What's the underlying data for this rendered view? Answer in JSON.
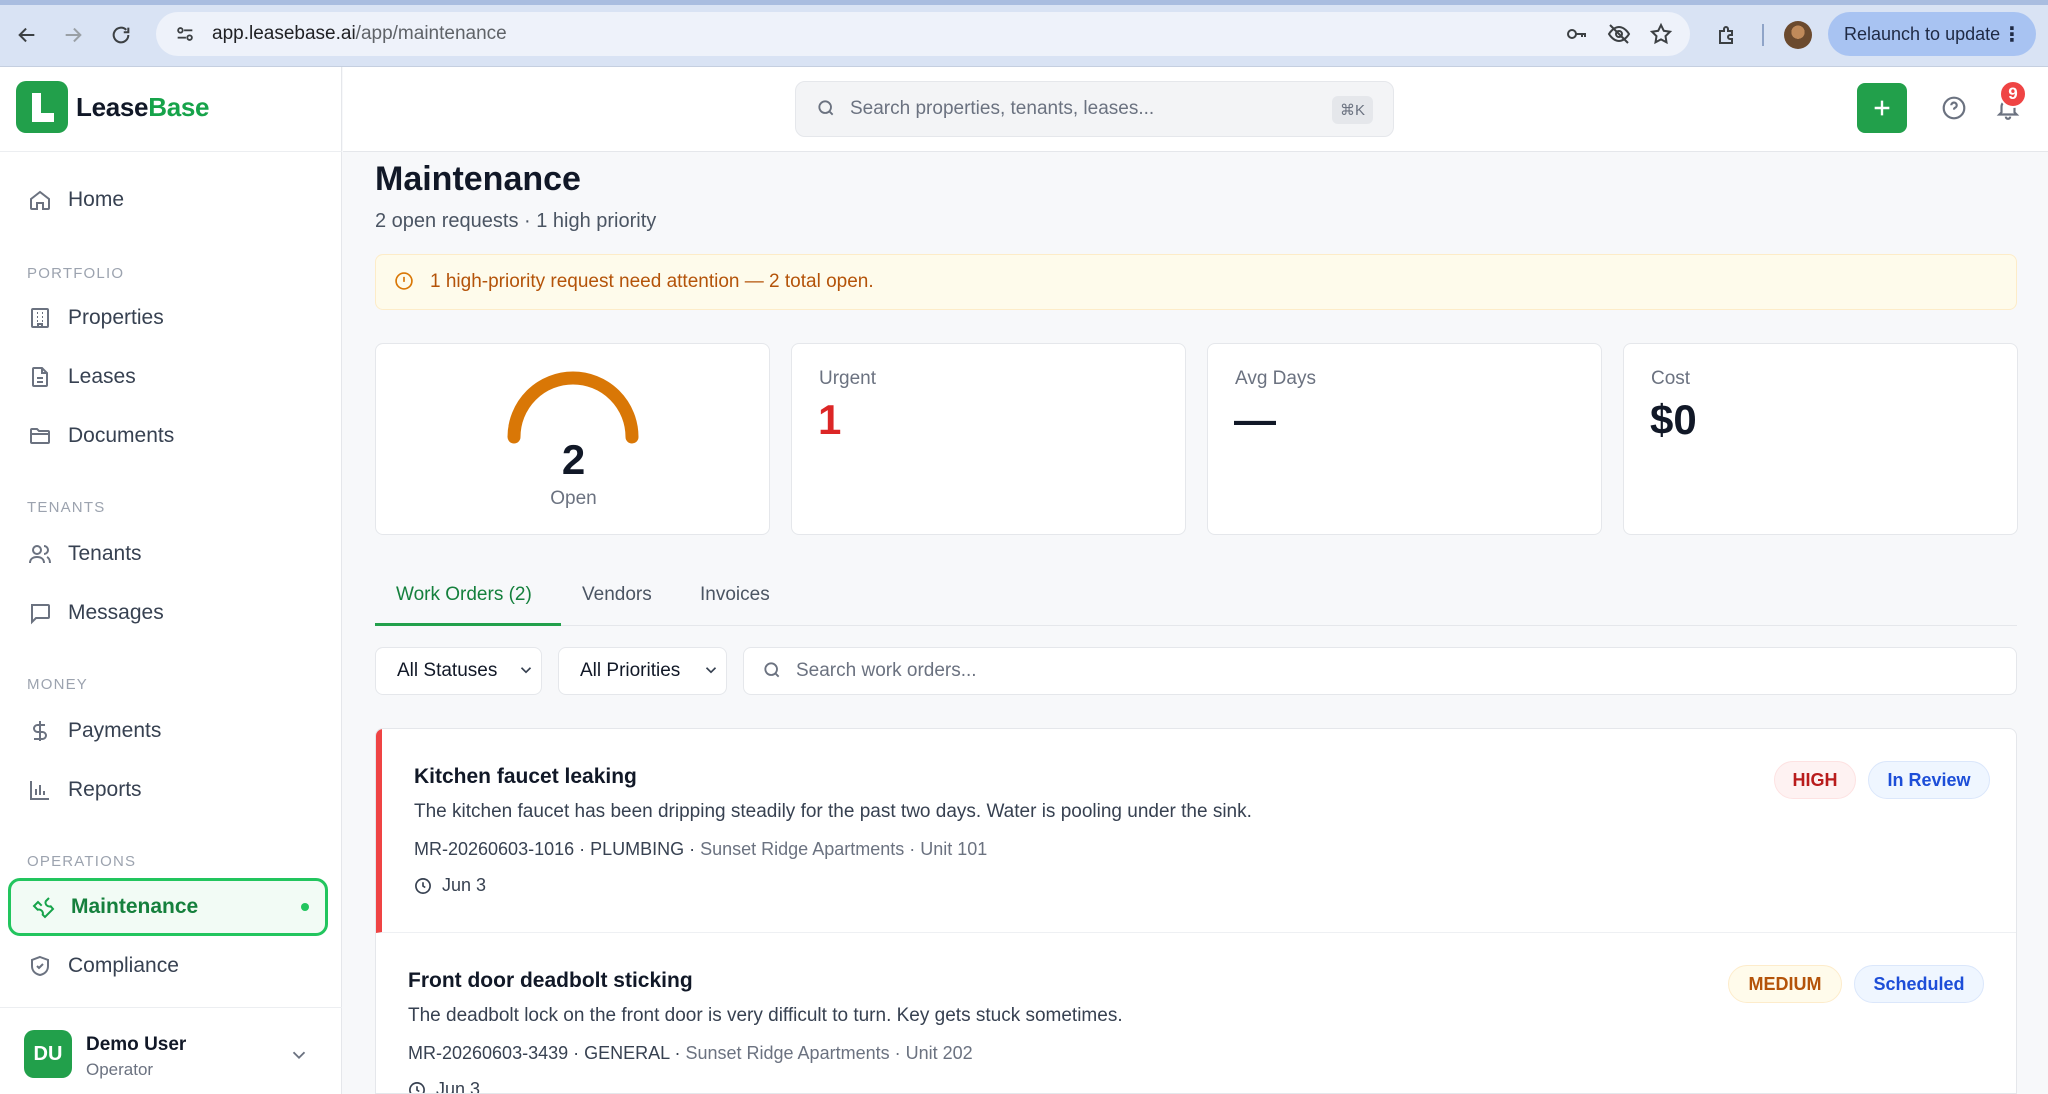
{
  "browser": {
    "url_domain": "app.leasebase.ai",
    "url_path": "/app/maintenance",
    "relaunch_label": "Relaunch to update"
  },
  "brand": {
    "name_part1": "Lease",
    "name_part2": "Base",
    "logo_letter": "L"
  },
  "sidebar": {
    "home": "Home",
    "sections": {
      "portfolio": "PORTFOLIO",
      "tenants": "TENANTS",
      "money": "MONEY",
      "operations": "OPERATIONS"
    },
    "items": {
      "properties": "Properties",
      "leases": "Leases",
      "documents": "Documents",
      "tenants": "Tenants",
      "messages": "Messages",
      "payments": "Payments",
      "reports": "Reports",
      "maintenance": "Maintenance",
      "compliance": "Compliance"
    },
    "user": {
      "initials": "DU",
      "name": "Demo User",
      "role": "Operator"
    }
  },
  "topbar": {
    "search_placeholder": "Search properties, tenants, leases...",
    "shortcut": "⌘K",
    "notification_count": "9"
  },
  "page": {
    "title": "Maintenance",
    "subtitle": "2 open requests · 1 high priority",
    "alert": "1 high-priority request need attention — 2 total open."
  },
  "stats": {
    "open_value": "2",
    "open_label": "Open",
    "urgent_label": "Urgent",
    "urgent_value": "1",
    "avg_label": "Avg Days",
    "avg_value": "—",
    "cost_label": "Cost",
    "cost_value": "$0"
  },
  "tabs": {
    "work_orders": "Work Orders (2)",
    "vendors": "Vendors",
    "invoices": "Invoices"
  },
  "filters": {
    "status": "All Statuses",
    "priority": "All Priorities",
    "search_placeholder": "Search work orders..."
  },
  "work_orders": [
    {
      "title": "Kitchen faucet leaking",
      "description": "The kitchen faucet has been dripping steadily for the past two days. Water is pooling under the sink.",
      "meta_id": "MR-20260603-1016 · PLUMBING · ",
      "meta_property": "Sunset Ridge Apartments · Unit 101",
      "date": "Jun 3",
      "priority": "HIGH",
      "status": "In Review"
    },
    {
      "title": "Front door deadbolt sticking",
      "description": "The deadbolt lock on the front door is very difficult to turn. Key gets stuck sometimes.",
      "meta_id": "MR-20260603-3439 · GENERAL · ",
      "meta_property": "Sunset Ridge Apartments · Unit 202",
      "date": "Jun 3",
      "priority": "MEDIUM",
      "status": "Scheduled"
    }
  ],
  "colors": {
    "brand_green": "#22a04b",
    "high_red": "#ef4444",
    "gauge_orange": "#d97706",
    "status_blue": "#1d4ed8"
  }
}
